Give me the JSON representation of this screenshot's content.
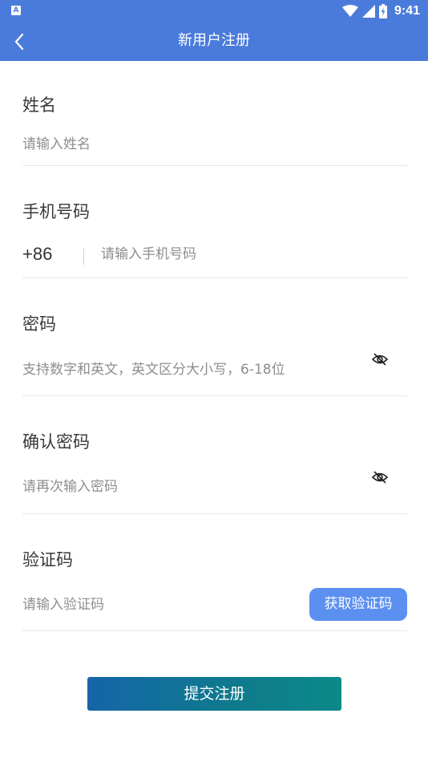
{
  "status_bar": {
    "time": "9:41",
    "app_badge": "A",
    "icons": [
      "wifi-icon",
      "signal-icon",
      "battery-charging-icon"
    ]
  },
  "navbar": {
    "title": "新用户注册",
    "back_icon": "chevron-left-icon"
  },
  "form": {
    "name": {
      "label": "姓名",
      "placeholder": "请输入姓名",
      "value": ""
    },
    "phone": {
      "label": "手机号码",
      "prefix": "+86",
      "placeholder": "请输入手机号码",
      "value": ""
    },
    "password": {
      "label": "密码",
      "placeholder": "支持数字和英文，英文区分大小写，6-18位",
      "value": "",
      "toggle_icon": "eye-slash-icon"
    },
    "confirm_password": {
      "label": "确认密码",
      "placeholder": "请再次输入密码",
      "value": "",
      "toggle_icon": "eye-slash-icon"
    },
    "code": {
      "label": "验证码",
      "placeholder": "请输入验证码",
      "value": "",
      "button_label": "获取验证码"
    }
  },
  "submit_label": "提交注册",
  "colors": {
    "header": "#4a7bdb",
    "code_button": "#5c90f0",
    "submit_gradient_start": "#1565a8",
    "submit_gradient_end": "#0a8a88"
  }
}
